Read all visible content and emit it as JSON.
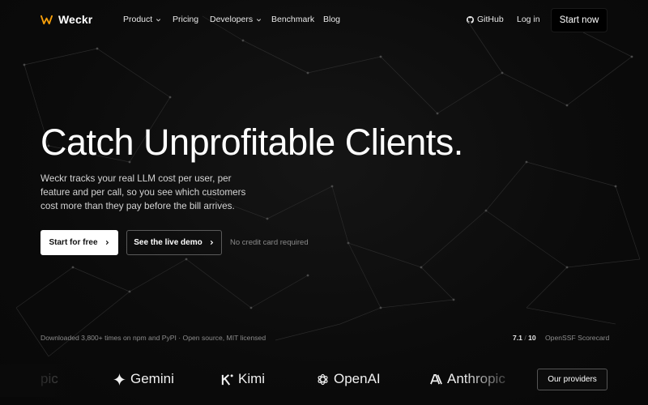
{
  "brand": {
    "name": "Weckr",
    "logo_icon": "weckr-logo-icon",
    "accent": "#f59e0b"
  },
  "nav": {
    "items": [
      {
        "label": "Product",
        "has_dropdown": true
      },
      {
        "label": "Pricing",
        "has_dropdown": false
      },
      {
        "label": "Developers",
        "has_dropdown": true
      },
      {
        "label": "Benchmark",
        "has_dropdown": false
      },
      {
        "label": "Blog",
        "has_dropdown": false
      }
    ],
    "github_label": "GitHub",
    "login_label": "Log in",
    "cta_label": "Start now"
  },
  "hero": {
    "title": "Catch Unprofitable Clients.",
    "subtitle": "Weckr tracks your real LLM cost per user, per feature and per call, so you see which customers cost more than they pay before the bill arrives.",
    "primary_cta": "Start for free",
    "secondary_cta": "See the live demo",
    "note": "No credit card required"
  },
  "stats": {
    "downloads": "Downloaded 3,800+ times on npm and PyPI · Open source, MIT licensed",
    "score_value": "7.1",
    "score_max": "10",
    "score_label": "OpenSSF Scorecard"
  },
  "providers": {
    "items": [
      {
        "name": "pic",
        "icon": "anthropic-icon"
      },
      {
        "name": "Gemini",
        "icon": "gemini-icon"
      },
      {
        "name": "Kimi",
        "icon": "kimi-icon"
      },
      {
        "name": "OpenAI",
        "icon": "openai-icon"
      },
      {
        "name": "Anthropic",
        "icon": "anthropic-icon"
      }
    ],
    "button_label": "Our providers"
  }
}
